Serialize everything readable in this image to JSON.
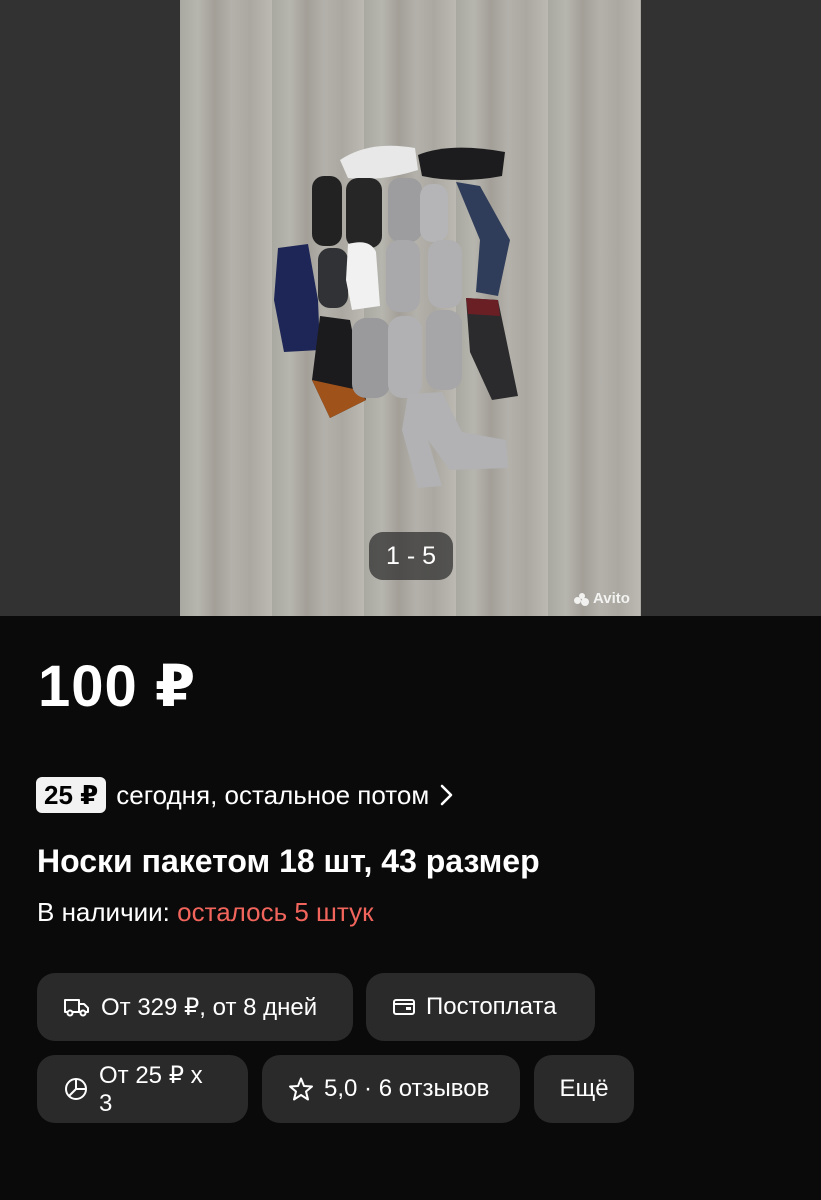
{
  "gallery": {
    "counter": "1 - 5",
    "watermark": "Avito"
  },
  "listing": {
    "price": "100 ₽",
    "installment": {
      "badge": "25 ₽",
      "text": "сегодня, остальное потом"
    },
    "title": "Носки пакетом 18 шт, 43 размер",
    "stock_label": "В наличии:",
    "stock_warning": "осталось 5 штук"
  },
  "chips": {
    "delivery": "От 329 ₽, от 8 дней",
    "payment": "Постоплата",
    "split": "От 25 ₽ x 3",
    "rating": "5,0 · 6 отзывов",
    "more": "Ещё"
  },
  "colors": {
    "background": "#0a0a0a",
    "chip": "#2a2a2a",
    "warning": "#f2655d"
  }
}
